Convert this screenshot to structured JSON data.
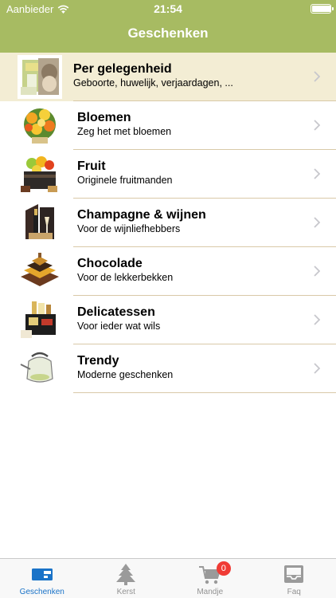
{
  "status_bar": {
    "carrier": "Aanbieder",
    "time": "21:54",
    "battery_level": 1.0
  },
  "nav": {
    "title": "Geschenken"
  },
  "categories": [
    {
      "title": "Per gelegenheid",
      "subtitle": "Geboorte, huwelijk, verjaardagen, ...",
      "icon": "occasion-gift-image",
      "selected": true
    },
    {
      "title": "Bloemen",
      "subtitle": "Zeg het met bloemen",
      "icon": "flowers-image",
      "selected": false
    },
    {
      "title": "Fruit",
      "subtitle": "Originele fruitmanden",
      "icon": "fruit-basket-image",
      "selected": false
    },
    {
      "title": "Champagne & wijnen",
      "subtitle": "Voor de wijnliefhebbers",
      "icon": "champagne-image",
      "selected": false
    },
    {
      "title": "Chocolade",
      "subtitle": "Voor de lekkerbekken",
      "icon": "chocolate-image",
      "selected": false
    },
    {
      "title": "Delicatessen",
      "subtitle": "Voor ieder wat wils",
      "icon": "delicatessen-image",
      "selected": false
    },
    {
      "title": "Trendy",
      "subtitle": "Moderne geschenken",
      "icon": "trendy-kettle-image",
      "selected": false
    }
  ],
  "tabbar": {
    "tabs": [
      {
        "label": "Geschenken",
        "icon": "gift-box-icon",
        "active": true
      },
      {
        "label": "Kerst",
        "icon": "christmas-tree-icon",
        "active": false
      },
      {
        "label": "Mandje",
        "icon": "shopping-cart-icon",
        "active": false,
        "badge": "0"
      },
      {
        "label": "Faq",
        "icon": "inbox-tray-icon",
        "active": false
      }
    ]
  },
  "colors": {
    "nav_background": "#a7bb62",
    "selected_row": "#f3edd4",
    "separator": "#d9c9a8",
    "tab_active": "#1a73c8",
    "tab_inactive": "#929292",
    "badge": "#f03b35"
  }
}
